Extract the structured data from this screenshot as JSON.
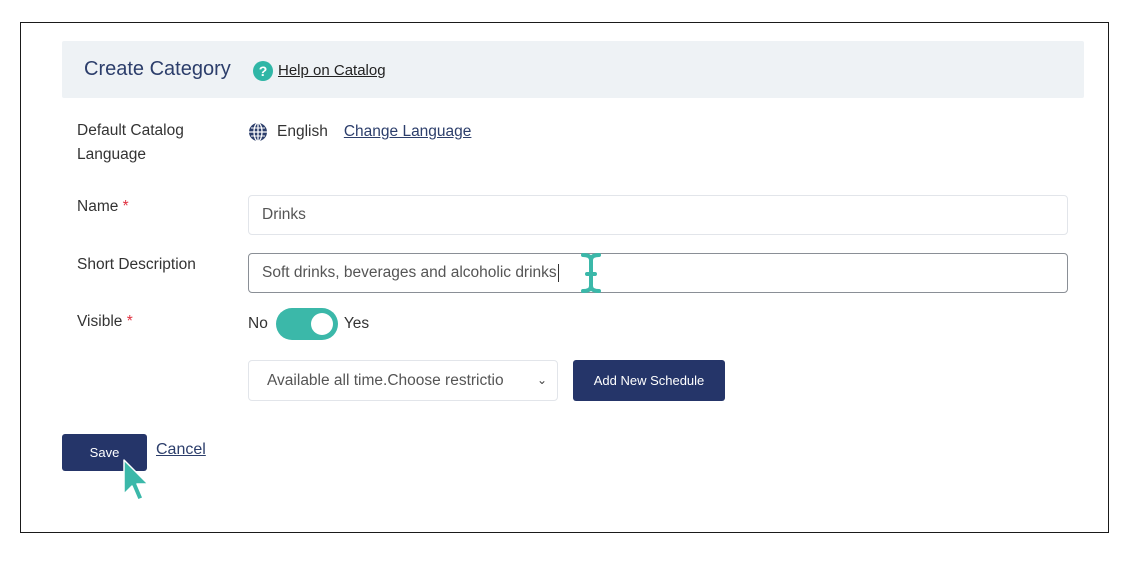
{
  "header": {
    "title": "Create Category",
    "help_icon": "question-circle-icon",
    "help_link": "Help on Catalog"
  },
  "form": {
    "default_language": {
      "label": "Default Catalog Language",
      "icon": "globe-icon",
      "value": "English",
      "change_link": "Change Language"
    },
    "name": {
      "label": "Name",
      "required_mark": "*",
      "value": "Drinks"
    },
    "short_description": {
      "label": "Short Description",
      "value": "Soft drinks, beverages and alcoholic drinks"
    },
    "visible": {
      "label": "Visible",
      "required_mark": "*",
      "off_label": "No",
      "on_label": "Yes",
      "state": "on"
    },
    "schedule": {
      "selected": "Available all time.Choose restrictio",
      "add_button": "Add New Schedule"
    }
  },
  "actions": {
    "save": "Save",
    "cancel": "Cancel"
  },
  "colors": {
    "primary": "#253569",
    "accent": "#3bb8a9",
    "header_bg": "#eef2f5",
    "required": "#e0303f"
  }
}
